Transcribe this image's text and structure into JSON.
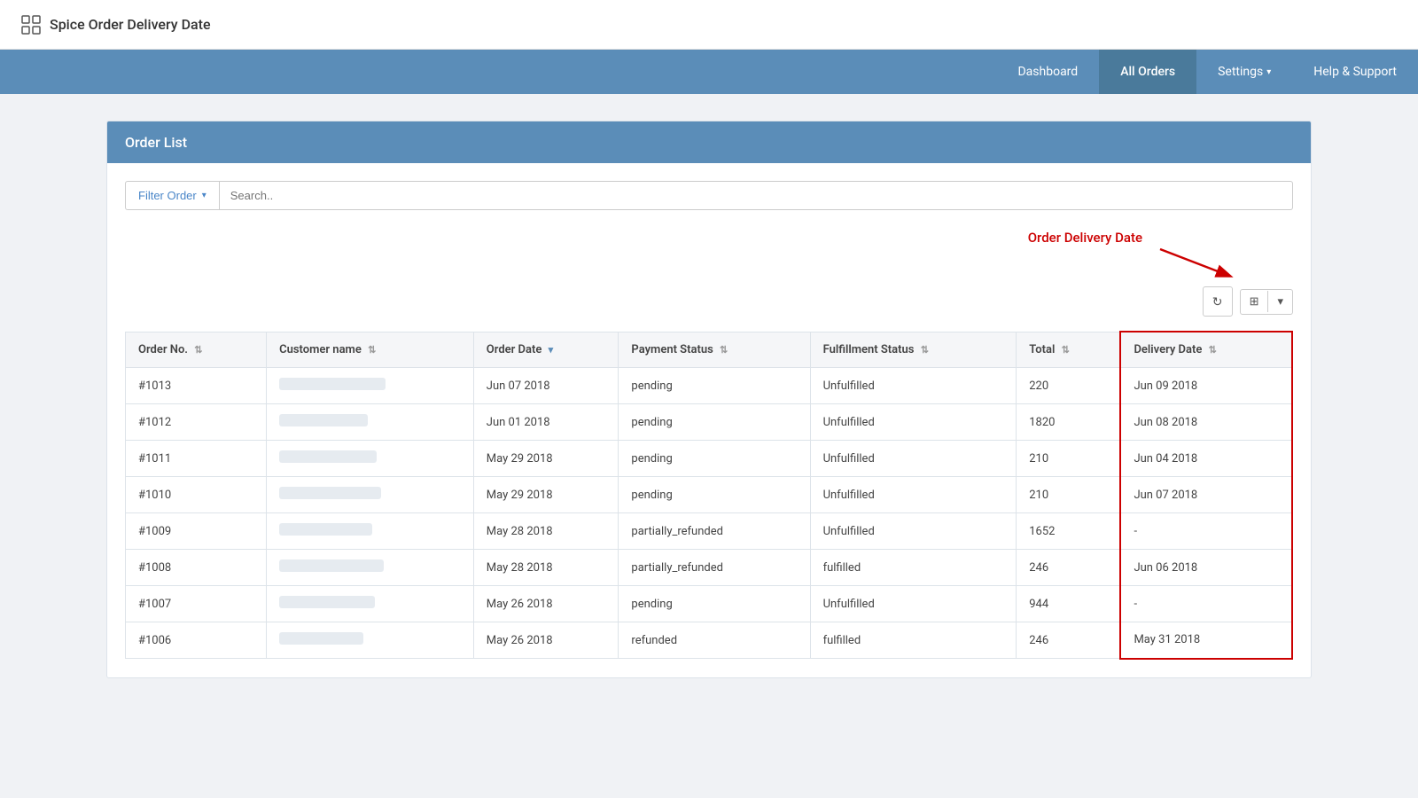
{
  "app": {
    "title": "Spice Order Delivery Date",
    "icon": "grid-icon"
  },
  "nav": {
    "items": [
      {
        "id": "dashboard",
        "label": "Dashboard",
        "active": false
      },
      {
        "id": "all-orders",
        "label": "All Orders",
        "active": true
      },
      {
        "id": "settings",
        "label": "Settings",
        "active": false,
        "dropdown": true
      },
      {
        "id": "help",
        "label": "Help & Support",
        "active": false
      }
    ]
  },
  "page": {
    "section_title": "Order List"
  },
  "filter": {
    "button_label": "Filter Order",
    "search_placeholder": "Search.."
  },
  "annotation": {
    "label": "Order Delivery Date"
  },
  "table_controls": {
    "refresh_icon": "↻",
    "grid_icon": "⊞",
    "dropdown_arrow": "▾"
  },
  "table": {
    "columns": [
      {
        "id": "order-no",
        "label": "Order No.",
        "sortable": true
      },
      {
        "id": "customer-name",
        "label": "Customer name",
        "sortable": true
      },
      {
        "id": "order-date",
        "label": "Order Date",
        "sortable": true,
        "sorted": true
      },
      {
        "id": "payment-status",
        "label": "Payment Status",
        "sortable": true
      },
      {
        "id": "fulfillment-status",
        "label": "Fulfillment Status",
        "sortable": true
      },
      {
        "id": "total",
        "label": "Total",
        "sortable": true
      },
      {
        "id": "delivery-date",
        "label": "Delivery Date",
        "sortable": true
      }
    ],
    "rows": [
      {
        "order_no": "#1013",
        "customer_name_width": 120,
        "order_date": "Jun 07 2018",
        "payment_status": "pending",
        "fulfillment_status": "Unfulfilled",
        "total": "220",
        "delivery_date": "Jun 09 2018"
      },
      {
        "order_no": "#1012",
        "customer_name_width": 100,
        "order_date": "Jun 01 2018",
        "payment_status": "pending",
        "fulfillment_status": "Unfulfilled",
        "total": "1820",
        "delivery_date": "Jun 08 2018"
      },
      {
        "order_no": "#1011",
        "customer_name_width": 110,
        "order_date": "May 29 2018",
        "payment_status": "pending",
        "fulfillment_status": "Unfulfilled",
        "total": "210",
        "delivery_date": "Jun 04 2018"
      },
      {
        "order_no": "#1010",
        "customer_name_width": 115,
        "order_date": "May 29 2018",
        "payment_status": "pending",
        "fulfillment_status": "Unfulfilled",
        "total": "210",
        "delivery_date": "Jun 07 2018"
      },
      {
        "order_no": "#1009",
        "customer_name_width": 105,
        "order_date": "May 28 2018",
        "payment_status": "partially_refunded",
        "fulfillment_status": "Unfulfilled",
        "total": "1652",
        "delivery_date": "-"
      },
      {
        "order_no": "#1008",
        "customer_name_width": 118,
        "order_date": "May 28 2018",
        "payment_status": "partially_refunded",
        "fulfillment_status": "fulfilled",
        "total": "246",
        "delivery_date": "Jun 06 2018"
      },
      {
        "order_no": "#1007",
        "customer_name_width": 108,
        "order_date": "May 26 2018",
        "payment_status": "pending",
        "fulfillment_status": "Unfulfilled",
        "total": "944",
        "delivery_date": "-"
      },
      {
        "order_no": "#1006",
        "customer_name_width": 95,
        "order_date": "May 26 2018",
        "payment_status": "refunded",
        "fulfillment_status": "fulfilled",
        "total": "246",
        "delivery_date": "May 31 2018"
      }
    ]
  }
}
